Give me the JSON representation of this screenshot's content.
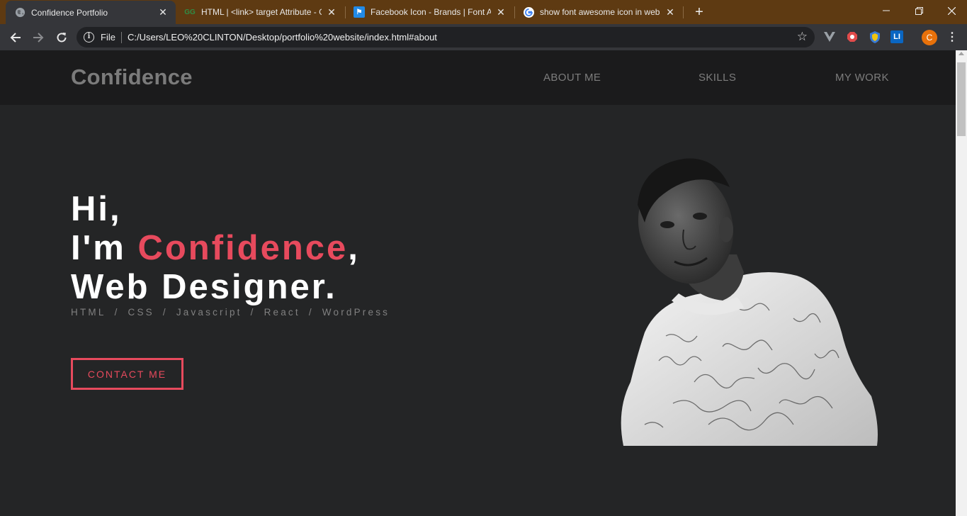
{
  "browser": {
    "tabs": [
      {
        "title": "Confidence Portfolio",
        "icon": "globe-icon",
        "active": true
      },
      {
        "title": "HTML | <link> target Attribute - G",
        "icon": "geeksforgeeks-icon",
        "active": false
      },
      {
        "title": "Facebook Icon - Brands | Font Aw",
        "icon": "flag-icon",
        "active": false
      },
      {
        "title": "show font awesome icon in webs",
        "icon": "google-icon",
        "active": false
      }
    ],
    "address": {
      "scheme_label": "File",
      "url": "C:/Users/LEO%20CLINTON/Desktop/portfolio%20website/index.html#about"
    },
    "profile_initial": "C",
    "extensions": [
      "vuejs-devtools-icon",
      "adblock-icon",
      "shield-extension-icon",
      "linkedin-icon"
    ]
  },
  "site": {
    "brand": "Confidence",
    "nav": [
      "ABOUT ME",
      "SKILLS",
      "MY WORK"
    ],
    "hero": {
      "line1": "Hi,",
      "line2_prefix": "I'm ",
      "line2_name": "Confidence",
      "line2_suffix": ",",
      "line3": "Web Designer."
    },
    "skills": [
      "HTML",
      "CSS",
      "Javascript",
      "React",
      "WordPress"
    ],
    "skills_separator": "/",
    "cta": "CONTACT ME",
    "colors": {
      "accent": "#e74a5d",
      "background": "#242526",
      "header": "#1b1b1c"
    }
  }
}
